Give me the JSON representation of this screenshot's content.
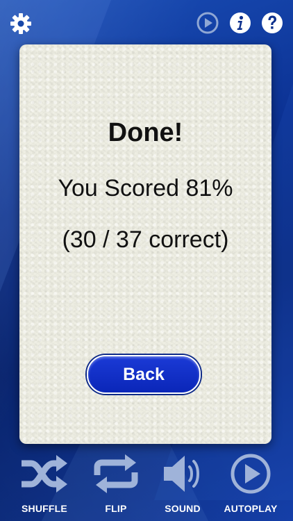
{
  "header": {
    "settings_icon": "gear-icon",
    "play_icon": "play-circle-icon",
    "info_icon": "info-icon",
    "help_icon": "question-icon"
  },
  "card": {
    "heading": "Done!",
    "score_text": "You Scored 81%",
    "correct_text": "(30 / 37 correct)",
    "back_label": "Back"
  },
  "toolbar": {
    "items": [
      {
        "label": "SHUFFLE",
        "icon": "shuffle-icon"
      },
      {
        "label": "FLIP",
        "icon": "repeat-icon"
      },
      {
        "label": "SOUND",
        "icon": "speaker-icon"
      },
      {
        "label": "AUTOPLAY",
        "icon": "play-circle-icon"
      }
    ]
  },
  "colors": {
    "background": "#0c3294",
    "card": "#eeeee2",
    "button": "#1530cc",
    "toolbar_icon": "#9fb3d9"
  }
}
